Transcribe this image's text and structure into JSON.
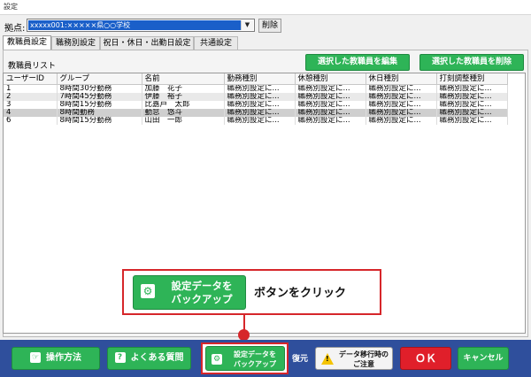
{
  "window": {
    "title": "設定"
  },
  "site": {
    "label": "拠点:",
    "selected": "xxxxx001:×××××県○○学校",
    "delete_label": "削除"
  },
  "tabs": [
    {
      "label": "教職員設定"
    },
    {
      "label": "職務別設定"
    },
    {
      "label": "祝日・休日・出勤日設定"
    },
    {
      "label": "共通設定"
    }
  ],
  "staff_list": {
    "label": "教職員リスト",
    "edit_button": "選択した教職員を編集",
    "delete_button": "選択した教職員を削除",
    "columns": [
      "ユーザーID",
      "グループ",
      "名前",
      "勤務種別",
      "休憩種別",
      "休日種別",
      "打刻調整種別"
    ],
    "rows": [
      [
        "1",
        "8時間30分勤務",
        "加藤　花子",
        "職務別設定に...",
        "職務別設定に...",
        "職務別設定に...",
        "職務別設定に..."
      ],
      [
        "2",
        "7時間45分勤務",
        "伊藤　裕子",
        "職務別設定に...",
        "職務別設定に...",
        "職務別設定に...",
        "職務別設定に..."
      ],
      [
        "3",
        "8時間15分勤務",
        "比嘉戸　太郎",
        "職務別設定に...",
        "職務別設定に...",
        "職務別設定に...",
        "職務別設定に..."
      ],
      [
        "4",
        "8時間勤務",
        "勤怠　悠斗",
        "職務別設定に...",
        "職務別設定に...",
        "職務別設定に...",
        "職務別設定に..."
      ],
      [
        "6",
        "8時間15分勤務",
        "山田　一郎",
        "職務別設定に...",
        "職務別設定に...",
        "職務別設定に...",
        "職務別設定に..."
      ]
    ]
  },
  "callout": {
    "button_line1": "設定データを",
    "button_line2": "バックアップ",
    "text": "ボタンをクリック"
  },
  "bottom": {
    "manual": "操作方法",
    "faq": "よくある質問",
    "backup_line1": "設定データを",
    "backup_line2": "バックアップ",
    "restore": "復元",
    "migrate_line1": "データ移行時の",
    "migrate_line2": "ご注意",
    "ok": "ＯＫ",
    "cancel": "キャンセル"
  },
  "colors": {
    "accent_green": "#2eb457",
    "bottom_bar": "#2f4f9c",
    "ok_red": "#e01f2a",
    "highlight_red": "#d6262a"
  },
  "icons": [
    "gear-icon",
    "manual-icon",
    "faq-icon",
    "warning-icon",
    "dropdown-arrow-icon"
  ]
}
